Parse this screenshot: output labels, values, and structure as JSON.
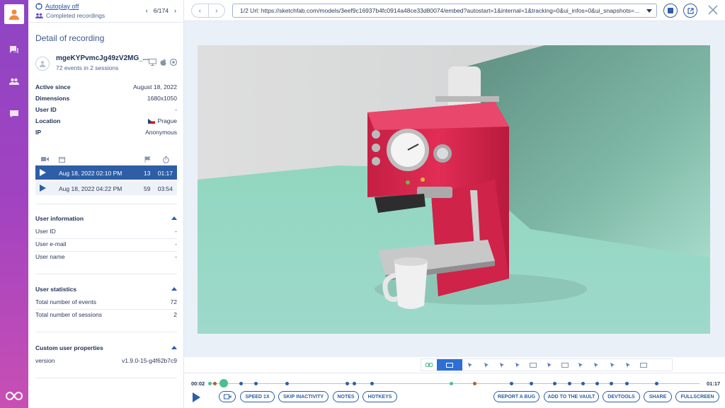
{
  "sidebar": {
    "autoplay_label": "Autoplay off",
    "completed_label": "Completed recordings",
    "pager": "6/174",
    "section_title": "Detail of recording",
    "user": {
      "name": "mgeKYPvmcJg49zV2MG_...",
      "summary": "72 events in 2 sessions"
    },
    "details": [
      {
        "key": "Active since",
        "value": "August 18, 2022"
      },
      {
        "key": "Dimensions",
        "value": "1680x1050"
      },
      {
        "key": "User ID",
        "value": "-"
      },
      {
        "key": "Location",
        "value": "Prague"
      },
      {
        "key": "IP",
        "value": "Anonymous"
      }
    ],
    "sessions": [
      {
        "date": "Aug 18, 2022  02:10 PM",
        "events": "13",
        "duration": "01:17",
        "active": true
      },
      {
        "date": "Aug 18, 2022  04:22 PM",
        "events": "59",
        "duration": "03:54",
        "active": false
      }
    ],
    "user_information": {
      "title": "User information",
      "rows": [
        {
          "key": "User ID",
          "value": "-"
        },
        {
          "key": "User e-mail",
          "value": "-"
        },
        {
          "key": "User name",
          "value": "-"
        }
      ]
    },
    "user_statistics": {
      "title": "User statistics",
      "rows": [
        {
          "key": "Total number of events",
          "value": "72"
        },
        {
          "key": "Total number of sessions",
          "value": "2"
        }
      ]
    },
    "custom_properties": {
      "title": "Custom user properties",
      "rows": [
        {
          "key": "version",
          "value": "v1.9.0-15-g4f62b7c9"
        }
      ]
    }
  },
  "header": {
    "url": "1/2 Url: https://sketchfab.com/models/3eef9c16937b4fc0914a48ce33d80074/embed?autostart=1&internal=1&tracking=0&ui_infos=0&ui_snapshots=..."
  },
  "player": {
    "time_current": "00:02",
    "time_total": "01:17",
    "buttons": {
      "speed": "SPEED 1X",
      "skip": "SKIP INACTIVITY",
      "notes": "NOTES",
      "hotkeys": "HOTKEYS",
      "bug": "REPORT A BUG",
      "vault": "ADD TO THE VAULT",
      "devtools": "DEVTOOLS",
      "share": "SHARE",
      "fullscreen": "FULLSCREEN"
    }
  },
  "colors": {
    "rail_top": "#8e44c4",
    "rail_bottom": "#c84fb4",
    "accent": "#2d5ea6",
    "green": "#4cbf8f",
    "machine_red": "#d8284e"
  }
}
